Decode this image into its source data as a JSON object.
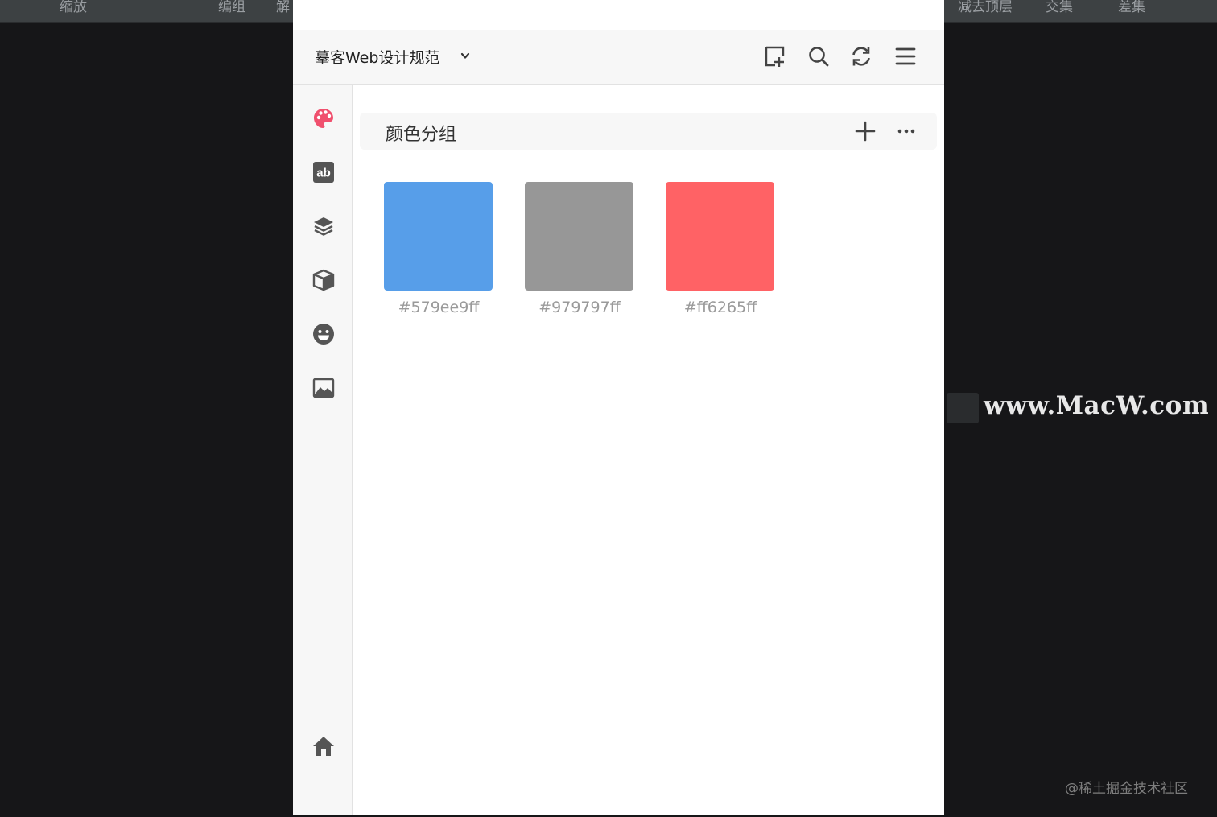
{
  "background_bar": {
    "items": [
      "缩放",
      "编组",
      "解",
      "减去顶层",
      "交集",
      "差集"
    ]
  },
  "header": {
    "project_title": "摹客Web设计规范",
    "icons": [
      "add-artboard-icon",
      "search-icon",
      "refresh-icon",
      "menu-icon"
    ]
  },
  "sidebar": {
    "items": [
      "palette-icon",
      "text-style-icon",
      "layers-icon",
      "component-icon",
      "emoji-icon",
      "image-icon",
      "home-icon"
    ],
    "active": "palette-icon",
    "accent_color": "#f0506e"
  },
  "color_group": {
    "title": "颜色分组",
    "actions": [
      "add-icon",
      "more-icon"
    ]
  },
  "swatches": [
    {
      "label": "#579ee9ff",
      "color": "#579ee9"
    },
    {
      "label": "#979797ff",
      "color": "#979797"
    },
    {
      "label": "#ff6265ff",
      "color": "#ff6265"
    }
  ],
  "watermark": {
    "text": "www.MacW.com"
  },
  "credit": "@稀土掘金技术社区"
}
